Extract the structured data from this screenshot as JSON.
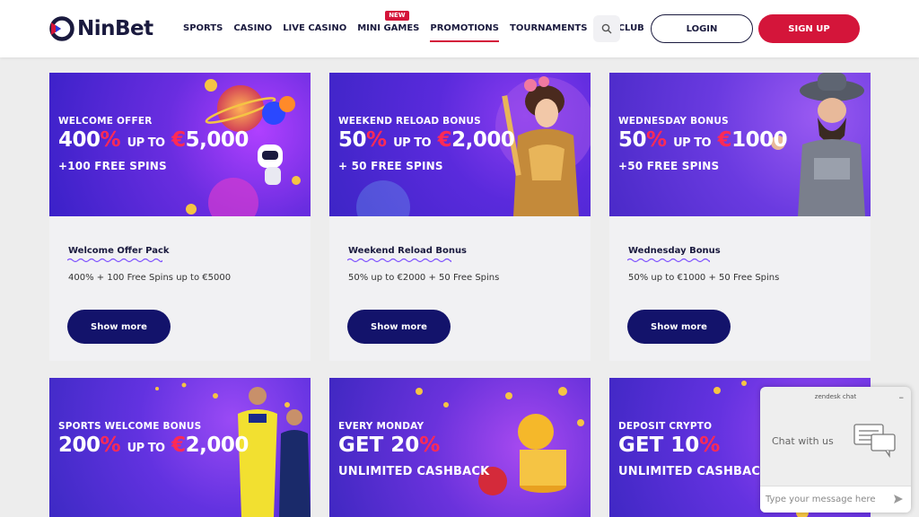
{
  "header": {
    "brand": "NinBet",
    "nav": [
      {
        "label": "SPORTS"
      },
      {
        "label": "CASINO"
      },
      {
        "label": "LIVE CASINO"
      },
      {
        "label": "MINI GAMES",
        "badge": "NEW"
      },
      {
        "label": "PROMOTIONS",
        "active": true
      },
      {
        "label": "TOURNAMENTS"
      },
      {
        "label": "VIP CLUB"
      }
    ],
    "login": "LOGIN",
    "signup": "SIGN UP"
  },
  "colors": {
    "accent": "#d4153a",
    "navy": "#13136b",
    "text": "#1a1a3e"
  },
  "cards": [
    {
      "banner": {
        "sub": "WELCOME OFFER",
        "pct": "400",
        "pct_sign": "%",
        "upto": "UP TO",
        "cur": "€",
        "amount": "5,000",
        "extra": "+100 FREE SPINS"
      },
      "title": "Welcome Offer Pack",
      "desc": "400% + 100 Free Spins up to €5000",
      "button": "Show more"
    },
    {
      "banner": {
        "sub": "WEEKEND RELOAD BONUS",
        "pct": "50",
        "pct_sign": "%",
        "upto": "UP TO",
        "cur": "€",
        "amount": "2,000",
        "extra": "+ 50 FREE SPINS"
      },
      "title": "Weekend Reload Bonus",
      "desc": "50% up to €2000 + 50 Free Spins",
      "button": "Show more"
    },
    {
      "banner": {
        "sub": "WEDNESDAY BONUS",
        "pct": "50",
        "pct_sign": "%",
        "upto": "UP TO",
        "cur": "€",
        "amount": "1000",
        "extra": "+50 FREE SPINS"
      },
      "title": "Wednesday Bonus",
      "desc": "50% up to €1000 + 50 Free Spins",
      "button": "Show more"
    }
  ],
  "cards_row2": [
    {
      "sub": "SPORTS WELCOME BONUS",
      "pct": "200",
      "pct_sign": "%",
      "upto": "UP TO",
      "cur": "€",
      "amount": "2,000"
    },
    {
      "sub": "EVERY MONDAY",
      "big": "GET 20",
      "pct_sign": "%",
      "cash": "UNLIMITED CASHBACK"
    },
    {
      "sub": "DEPOSIT CRYPTO",
      "big": "GET 10",
      "pct_sign": "%",
      "cash": "UNLIMITED CASHBACK"
    }
  ],
  "chat": {
    "title": "zendesk chat",
    "prompt": "Chat with us",
    "placeholder": "Type your message here"
  }
}
